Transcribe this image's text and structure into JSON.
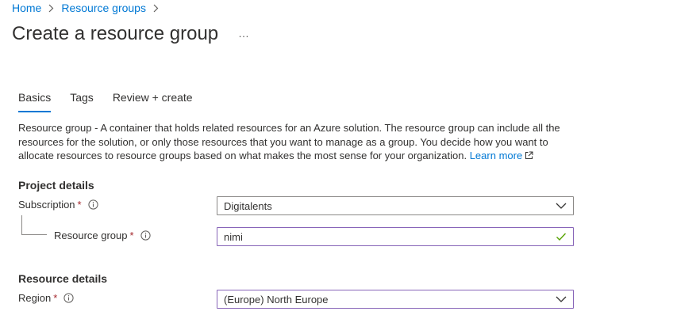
{
  "breadcrumb": {
    "items": [
      "Home",
      "Resource groups"
    ]
  },
  "page": {
    "title": "Create a resource group",
    "more": "…"
  },
  "tabs": [
    {
      "label": "Basics",
      "active": true
    },
    {
      "label": "Tags",
      "active": false
    },
    {
      "label": "Review + create",
      "active": false
    }
  ],
  "description": {
    "term": "Resource group",
    "text": " - A container that holds related resources for an Azure solution. The resource group can include all the resources for the solution, or only those resources that you want to manage as a group. You decide how you want to allocate resources to resource groups based on what makes the most sense for your organization. ",
    "link": "Learn more"
  },
  "project_details": {
    "heading": "Project details",
    "subscription": {
      "label": "Subscription",
      "required": "*",
      "value": "Digitalents"
    },
    "resource_group": {
      "label": "Resource group",
      "required": "*",
      "value": "nimi"
    }
  },
  "resource_details": {
    "heading": "Resource details",
    "region": {
      "label": "Region",
      "required": "*",
      "value": "(Europe) North Europe"
    }
  },
  "colors": {
    "accent": "#0078d4",
    "required": "#a4262c",
    "valid": "#8764b8",
    "check": "#57a300"
  },
  "icons": [
    "chevron-right-icon",
    "info-icon",
    "external-link-icon",
    "chevron-down-icon",
    "checkmark-icon"
  ]
}
